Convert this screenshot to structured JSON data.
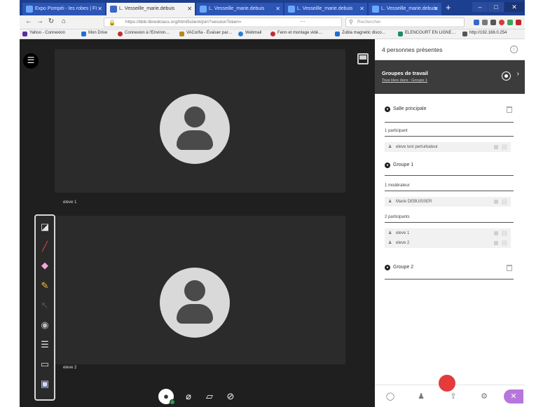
{
  "browser": {
    "tabs": [
      {
        "title": "Expo Pompéi - les robes | FI",
        "active": false
      },
      {
        "title": "L. Vesseille_marie.debuis",
        "active": true
      },
      {
        "title": "L. Vesseille_marie.debuis",
        "active": false
      },
      {
        "title": "L. Vesseille_marie.debuis",
        "active": false
      },
      {
        "title": "L. Vesseille_marie.debuis",
        "active": false
      }
    ],
    "new_tab_icon": "plus-icon",
    "url": "https://bbb.libredclass.org/html5client/join?sessionToken=",
    "url_more": "···",
    "search_placeholder": "Rechercher",
    "bookmarks": [
      {
        "label": "Yahoo - Connexion",
        "color": "#5a2ca0"
      },
      {
        "label": "Mon Drive",
        "color": "#1f6fd1"
      },
      {
        "label": "Connexion à l'Environ…",
        "color": "#c52b2b"
      },
      {
        "label": "VACorfia - Évaluer par…",
        "color": "#b9881d"
      },
      {
        "label": "Webmail",
        "color": "#2a7fd4"
      },
      {
        "label": "Fenn et montage vidé…",
        "color": "#c52b2b"
      },
      {
        "label": "Zubla magnetic disco…",
        "color": "#1f6fd1"
      },
      {
        "label": "ELENCOURT EN LIGNE…",
        "color": "#1f8a6a"
      },
      {
        "label": "http://192.168.0.254",
        "color": "#555555"
      }
    ]
  },
  "conference": {
    "tiles": [
      {
        "name": "eleve 1"
      },
      {
        "name": "eleve 2"
      }
    ],
    "whiteboard_tools": [
      "shapes-icon",
      "pen-icon",
      "eraser-icon",
      "highlighter-icon",
      "pointer-icon",
      "color-picker-icon",
      "line-width-icon",
      "monitor-icon",
      "screen-share-icon"
    ],
    "controls": [
      "user-status-icon",
      "mic-off-icon",
      "camera-off-icon",
      "share-off-icon"
    ]
  },
  "panel": {
    "title": "4 personnes présentes",
    "groups_title": "Groupes de travail",
    "groups_subtitle": "Tous likes dans : Groupe 1",
    "rooms": [
      {
        "title": "Salle principale",
        "sections": [
          {
            "label": "1 participant",
            "people": [
              "eleve test perturbateur"
            ]
          }
        ]
      },
      {
        "title": "Groupe 1",
        "sections": [
          {
            "label": "1 modérateur",
            "people": [
              "Marie DEBUISSER"
            ]
          },
          {
            "label": "2 participants",
            "people": [
              "eleve 1",
              "eleve 2"
            ]
          }
        ]
      },
      {
        "title": "Groupe 2",
        "sections": []
      }
    ],
    "footer_icons": [
      "chat-icon",
      "participants-icon",
      "share-icon",
      "settings-icon",
      "close-icon"
    ]
  }
}
